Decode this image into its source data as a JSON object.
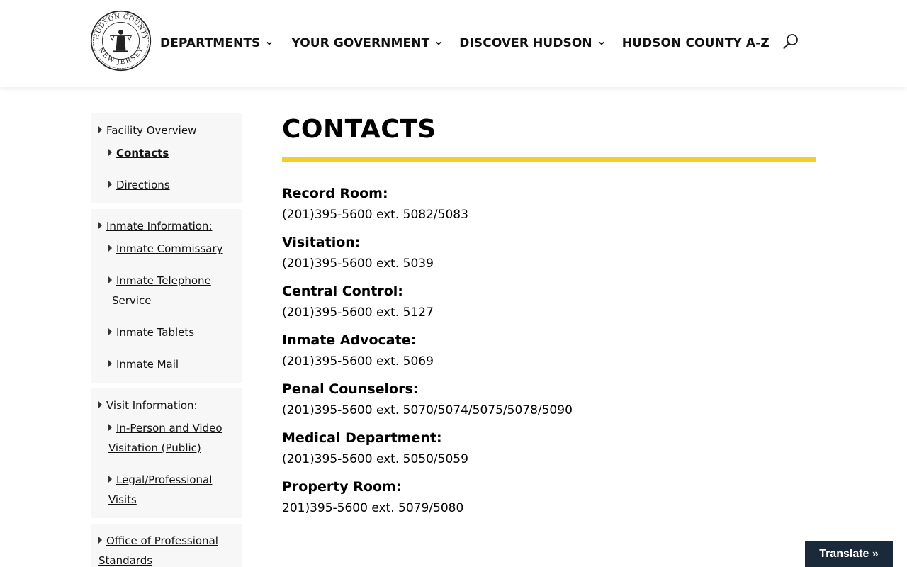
{
  "header": {
    "seal_text_top": "HUDSON COUNTY",
    "seal_text_bottom": "NEW JERSEY",
    "nav": [
      {
        "label": "DEPARTMENTS",
        "has_dropdown": true
      },
      {
        "label": "YOUR GOVERNMENT",
        "has_dropdown": true
      },
      {
        "label": "DISCOVER HUDSON",
        "has_dropdown": true
      },
      {
        "label": "HUDSON COUNTY A-Z",
        "has_dropdown": false
      }
    ],
    "search_icon": "search-icon"
  },
  "sidebar": {
    "blocks": [
      {
        "title": "Facility Overview",
        "items": [
          "Contacts",
          "Directions"
        ]
      },
      {
        "title": "Inmate Information:",
        "items": [
          "Inmate Commissary",
          "Inmate Telephone Service",
          "Inmate Tablets",
          "Inmate Mail"
        ]
      },
      {
        "title": "Visit Information:",
        "items": [
          "In-Person and Video Visitation (Public)",
          "Legal/Professional Visits"
        ]
      },
      {
        "title": "Office of Professional Standards",
        "items": []
      }
    ]
  },
  "main": {
    "title": "CONTACTS",
    "contacts": [
      {
        "label": "Record Room:",
        "value": "(201)395-5600 ext. 5082/5083"
      },
      {
        "label": "Visitation:",
        "value": "(201)395-5600 ext. 5039"
      },
      {
        "label": "Central Control:",
        "value": "(201)395-5600 ext. 5127"
      },
      {
        "label": "Inmate Advocate:",
        "value": "(201)395-5600 ext. 5069"
      },
      {
        "label": "Penal Counselors:",
        "value": "(201)395-5600 ext. 5070/5074/5075/5078/5090"
      },
      {
        "label": "Medical Department:",
        "value": "(201)395-5600 ext. 5050/5059"
      },
      {
        "label": "Property Room:",
        "value": "201)395-5600 ext. 5079/5080"
      }
    ]
  },
  "translate": {
    "label": "Translate »"
  },
  "colors": {
    "accent_bar": "#f2d02a",
    "translate_bg": "#1b2a3a",
    "sidebar_bg": "#f7f7f7"
  }
}
